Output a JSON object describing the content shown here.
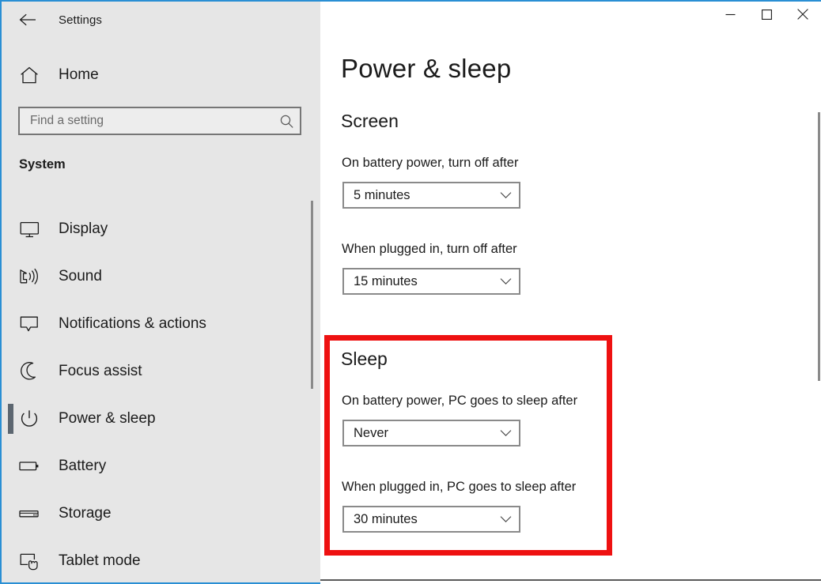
{
  "window": {
    "title": "Settings",
    "back_icon": "back-arrow-icon",
    "controls": {
      "minimize": "minimize-icon",
      "maximize": "maximize-icon",
      "close": "close-icon"
    }
  },
  "sidebar": {
    "home": {
      "label": "Home",
      "icon": "home-icon"
    },
    "search": {
      "placeholder": "Find a setting",
      "value": "",
      "icon": "search-icon"
    },
    "section_header": "System",
    "items": [
      {
        "label": "Display",
        "icon": "monitor-icon",
        "selected": false
      },
      {
        "label": "Sound",
        "icon": "speaker-icon",
        "selected": false
      },
      {
        "label": "Notifications & actions",
        "icon": "speech-bubble-icon",
        "selected": false
      },
      {
        "label": "Focus assist",
        "icon": "moon-icon",
        "selected": false
      },
      {
        "label": "Power & sleep",
        "icon": "power-icon",
        "selected": true
      },
      {
        "label": "Battery",
        "icon": "battery-icon",
        "selected": false
      },
      {
        "label": "Storage",
        "icon": "storage-drive-icon",
        "selected": false
      },
      {
        "label": "Tablet mode",
        "icon": "tablet-hand-icon",
        "selected": false
      }
    ]
  },
  "main": {
    "page_title": "Power & sleep",
    "groups": {
      "screen": {
        "heading": "Screen",
        "battery": {
          "label": "On battery power, turn off after",
          "value": "5 minutes"
        },
        "plugged": {
          "label": "When plugged in, turn off after",
          "value": "15 minutes"
        }
      },
      "sleep": {
        "heading": "Sleep",
        "battery": {
          "label": "On battery power, PC goes to sleep after",
          "value": "Never"
        },
        "plugged": {
          "label": "When plugged in, PC goes to sleep after",
          "value": "30 minutes"
        }
      }
    }
  },
  "annotation": {
    "highlight_color": "#ee1111",
    "highlight_target": "sleep"
  },
  "colors": {
    "sidebar_background": "#e6e6e6",
    "content_background": "#ffffff",
    "text_primary": "#1b1b1b",
    "text_muted": "#6b6b6b",
    "control_border": "#8a8a8a",
    "selection_indicator": "#5c6670",
    "window_accent": "#2a8fd4"
  }
}
